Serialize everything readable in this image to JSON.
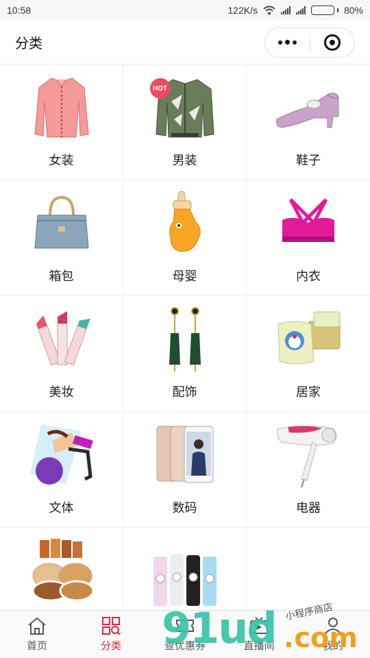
{
  "status_bar": {
    "time": "10:58",
    "net_speed": "122K/s",
    "battery": "80%",
    "battery_level": 0.8
  },
  "header": {
    "title": "分类"
  },
  "categories": [
    {
      "label": "女装",
      "icon": "blouse-icon"
    },
    {
      "label": "男装",
      "icon": "jacket-icon",
      "badge": "HOT"
    },
    {
      "label": "鞋子",
      "icon": "shoe-icon"
    },
    {
      "label": "箱包",
      "icon": "handbag-icon"
    },
    {
      "label": "母婴",
      "icon": "baby-bottle-icon"
    },
    {
      "label": "内衣",
      "icon": "bra-icon"
    },
    {
      "label": "美妆",
      "icon": "lipstick-icon"
    },
    {
      "label": "配饰",
      "icon": "earrings-icon"
    },
    {
      "label": "居家",
      "icon": "pillow-icon"
    },
    {
      "label": "文体",
      "icon": "fitness-ball-icon"
    },
    {
      "label": "数码",
      "icon": "smartphone-icon"
    },
    {
      "label": "电器",
      "icon": "hair-dryer-icon"
    },
    {
      "label": "",
      "icon": "nuts-icon"
    },
    {
      "label": "",
      "icon": "bottles-icon"
    }
  ],
  "tabbar": {
    "items": [
      {
        "label": "首页",
        "icon": "home-icon"
      },
      {
        "label": "分类",
        "icon": "category-grid-icon",
        "active": true
      },
      {
        "label": "查优惠券",
        "icon": "coupon-icon"
      },
      {
        "label": "直播间",
        "icon": "live-tv-icon"
      },
      {
        "label": "我的",
        "icon": "user-icon"
      }
    ]
  },
  "watermark": {
    "digits": "91ud",
    "suffix": ".com",
    "cn": "小程序商店"
  },
  "colors": {
    "accent": "#e0263a",
    "watermark_green": "#37c4a8",
    "watermark_orange": "#f29a16"
  }
}
